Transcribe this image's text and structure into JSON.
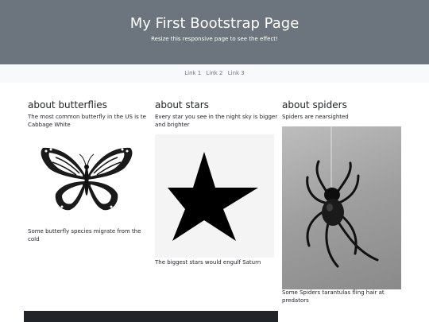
{
  "header": {
    "title": "My First Bootstrap Page",
    "subtitle": "Resize this responsive page to see the effect!"
  },
  "nav": {
    "links": [
      "Link 1",
      "Link 2",
      "Link 3"
    ]
  },
  "columns": [
    {
      "heading": "about butterflies",
      "intro": "The most common butterfly in the US is te Cabbage White",
      "image": "butterfly-image",
      "caption": "Some butterfly species migrate from the cold"
    },
    {
      "heading": "about stars",
      "intro": "Every star you see in the night sky is bigger and brighter",
      "image": "star-image",
      "caption": "The biggest stars would engulf Saturn"
    },
    {
      "heading": "about spiders",
      "intro": "Spiders are nearsighted",
      "image": "spider-image",
      "caption": "Some Spiders tarantulas fling hair at predators"
    }
  ],
  "colors": {
    "jumbotron": "#6c757d",
    "nav_bg": "#f8f9fa",
    "footer": "#212529"
  }
}
